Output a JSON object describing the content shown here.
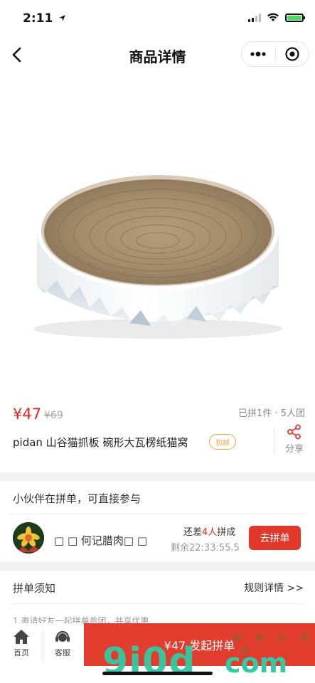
{
  "status_bar": {
    "time": "2:11",
    "location_arrow": "location-arrow-icon"
  },
  "nav": {
    "title": "商品详情"
  },
  "colors": {
    "accent_red": "#e1251b",
    "button_red": "#e1382b",
    "tag_orange": "#e9a23b",
    "watermark_teal": "#33c9a2"
  },
  "product": {
    "price": "¥47",
    "original_price": "¥69",
    "sold_info": "已拼1件 · 5人团",
    "title": "pidan 山谷猫抓板 碗形大瓦楞纸猫窝",
    "tag": "包邮",
    "share_label": "分享"
  },
  "group": {
    "header": "小伙伴在拼单，可直接参与",
    "member_name": "□ □ 何记腊肉□ □",
    "lack_prefix": "还差",
    "lack_count": "4人",
    "lack_suffix": "拼成",
    "remaining": "剩余22:33:55.5",
    "join_label": "去拼单"
  },
  "rules": {
    "title": "拼单须知",
    "link": "规则详情 >>",
    "text": "1.邀请好友一起拼单参团，共享优惠"
  },
  "bottom_bar": {
    "home_label": "首页",
    "service_label": "客服",
    "start_label": "¥47 发起拼单"
  },
  "watermark": {
    "text": "9i0d",
    "suffix": "com",
    "sub": "我 · 爱 · 好 · 源 · 码"
  }
}
